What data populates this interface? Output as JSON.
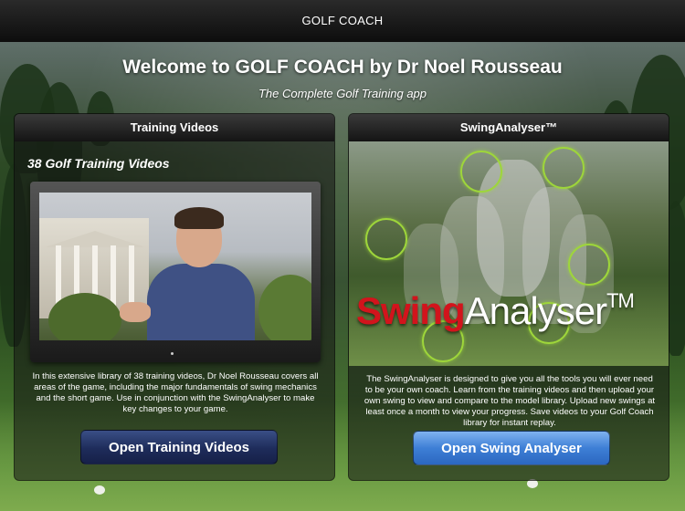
{
  "app": {
    "title": "GOLF COACH",
    "welcome": "Welcome to GOLF COACH by Dr Noel Rousseau",
    "subtitle": "The Complete Golf Training app"
  },
  "training": {
    "header": "Training Videos",
    "heading": "38 Golf Training Videos",
    "description": "In this extensive library of 38 training videos, Dr Noel Rousseau covers all areas of the game, including the major fundamentals of swing mechanics and the short game. Use in conjunction with the SwingAnalyser to make key changes to your game.",
    "button_label": "Open Training Videos"
  },
  "swing": {
    "header": "SwingAnalyser™",
    "logo_red": "Swing",
    "logo_white": "Analyser",
    "logo_tm": "TM",
    "description": "The SwingAnalyser is designed to give you all the tools you will ever need to be your own coach. Learn from the training videos and then upload your own swing to view and compare to the model library. Upload new swings at least once a month to view your progress. Save videos to your Golf Coach library for instant replay.",
    "button_label": "Open Swing Analyser"
  },
  "colors": {
    "accent_red": "#d2141c",
    "button_dark": "#1e2c5a",
    "button_light": "#3e7fd6",
    "ring_green": "#9ed63a"
  }
}
